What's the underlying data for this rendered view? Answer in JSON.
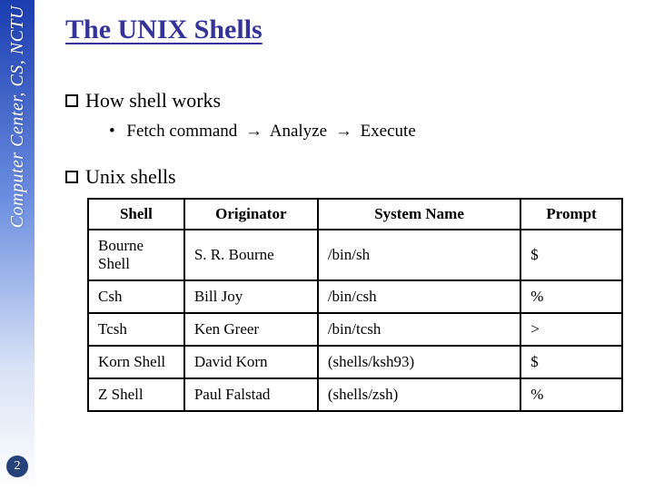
{
  "sidebar": {
    "label": "Computer Center, CS, NCTU",
    "slide_number": "2"
  },
  "title": "The UNIX Shells",
  "sections": {
    "how": {
      "heading": "How shell works",
      "sub_parts": {
        "a": "Fetch command",
        "b": "Analyze",
        "c": "Execute"
      }
    },
    "shells": {
      "heading": "Unix shells"
    }
  },
  "table": {
    "headers": {
      "c0": "Shell",
      "c1": "Originator",
      "c2": "System Name",
      "c3": "Prompt"
    },
    "rows": [
      {
        "shell": "Bourne Shell",
        "originator": "S. R. Bourne",
        "system": "/bin/sh",
        "prompt": "$"
      },
      {
        "shell": "Csh",
        "originator": "Bill Joy",
        "system": "/bin/csh",
        "prompt": "%"
      },
      {
        "shell": "Tcsh",
        "originator": "Ken Greer",
        "system": "/bin/tcsh",
        "prompt": ">"
      },
      {
        "shell": "Korn Shell",
        "originator": "David Korn",
        "system": "(shells/ksh93)",
        "prompt": "$"
      },
      {
        "shell": "Z Shell",
        "originator": "Paul Falstad",
        "system": "(shells/zsh)",
        "prompt": "%"
      }
    ]
  }
}
